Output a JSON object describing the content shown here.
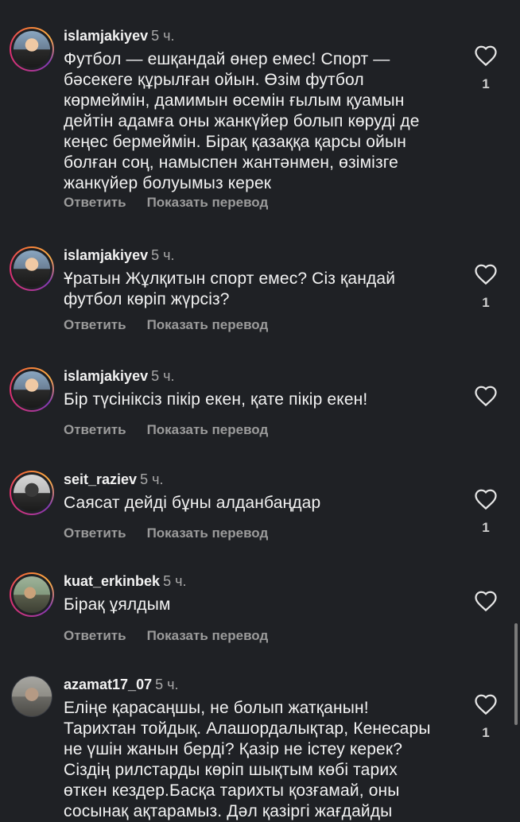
{
  "comments": [
    {
      "username": "islamjakiyev",
      "time": "5 ч.",
      "text": "Футбол — ешқандай өнер емес! Спорт — бәсекеге құрылған ойын. Өзім футбол көрмеймін, дамимын өсемін ғылым қуамын дейтін адамға оны жанкүйер болып көруді де кеңес бермеймін. Бірақ қазаққа қарсы ойын болған соң, намыспен жантәнмен, өзімізге жанкүйер болуымыз керек",
      "reply_label": "Ответить",
      "translate_label": "Показать перевод",
      "likes": "1",
      "avatar_icon": "user-avatar-icon"
    },
    {
      "username": "islamjakiyev",
      "time": "5 ч.",
      "text": "Ұратын Жұлқитын спорт емес? Сіз қандай футбол көріп жүрсіз?",
      "reply_label": "Ответить",
      "translate_label": "Показать перевод",
      "likes": "1",
      "avatar_icon": "user-avatar-icon"
    },
    {
      "username": "islamjakiyev",
      "time": "5 ч.",
      "text": "Бір түсініксіз пікір екен, қате пікір екен!",
      "reply_label": "Ответить",
      "translate_label": "Показать перевод",
      "likes": "",
      "avatar_icon": "user-avatar-icon"
    },
    {
      "username": "seit_raziev",
      "time": "5 ч.",
      "text": "Саясат дейді бұны алданбаңдар",
      "reply_label": "Ответить",
      "translate_label": "Показать перевод",
      "likes": "1",
      "avatar_icon": "user-avatar-icon"
    },
    {
      "username": "kuat_erkinbek",
      "time": "5 ч.",
      "text": "Бірақ ұялдым",
      "reply_label": "Ответить",
      "translate_label": "Показать перевод",
      "likes": "",
      "avatar_icon": "user-avatar-icon"
    },
    {
      "username": "azamat17_07",
      "time": "5 ч.",
      "text": "Еліңе қарасаңшы, не болып жатқанын! Тарихтан тойдық. Алашордалықтар, Кенесары не үшін жанын берді? Қазір не істеу керек? Сіздің рилстарды көріп шықтым көбі тарих өткен кездер.Басқа тарихты қозғамай, оны сосынақ ақтарамыз. Дәл қазіргі жағдайды",
      "reply_label": "",
      "translate_label": "",
      "likes": "1",
      "avatar_icon": "user-avatar-icon"
    }
  ],
  "colors": {
    "background": "#1f2125",
    "text": "#f2f2f2",
    "secondary": "#9b9b9b",
    "story_ring": "#e1306c"
  },
  "icons": {
    "like": "heart-outline-icon"
  }
}
